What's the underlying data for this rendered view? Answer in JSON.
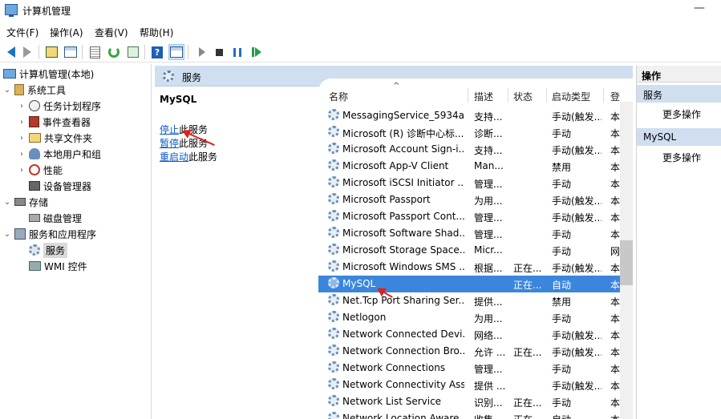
{
  "window": {
    "title": "计算机管理",
    "minimize_glyph": "—"
  },
  "menu": [
    "文件(F)",
    "操作(A)",
    "查看(V)",
    "帮助(H)"
  ],
  "tree": [
    {
      "label": "计算机管理(本地)",
      "icon": "computer-icon",
      "chev": ""
    },
    {
      "label": "系统工具",
      "icon": "tools-icon",
      "chev": "⌄"
    },
    {
      "label": "任务计划程序",
      "icon": "clock-icon",
      "chev": "›"
    },
    {
      "label": "事件查看器",
      "icon": "event-viewer-icon",
      "chev": "›"
    },
    {
      "label": "共享文件夹",
      "icon": "shared-folder-icon",
      "chev": "›"
    },
    {
      "label": "本地用户和组",
      "icon": "users-icon",
      "chev": "›"
    },
    {
      "label": "性能",
      "icon": "performance-icon",
      "chev": "›"
    },
    {
      "label": "设备管理器",
      "icon": "device-manager-icon",
      "chev": ""
    },
    {
      "label": "存储",
      "icon": "storage-icon",
      "chev": "⌄"
    },
    {
      "label": "磁盘管理",
      "icon": "disk-icon",
      "chev": ""
    },
    {
      "label": "服务和应用程序",
      "icon": "services-apps-icon",
      "chev": "⌄"
    },
    {
      "label": "服务",
      "icon": "gear-icon",
      "chev": ""
    },
    {
      "label": "WMI 控件",
      "icon": "wmi-icon",
      "chev": ""
    }
  ],
  "header": {
    "label": "服务"
  },
  "detail": {
    "name": "MySQL",
    "stop_link": "停止",
    "stop_suffix": "此服务",
    "pause_link": "暂停",
    "pause_suffix": "此服务",
    "restart_link": "重启动",
    "restart_suffix": "此服务"
  },
  "columns": {
    "name": "名称",
    "desc": "描述",
    "status": "状态",
    "startup": "启动类型",
    "logon": "登"
  },
  "services": [
    {
      "name": "MessagingService_5934a",
      "desc": "支持...",
      "status": "",
      "startup": "手动(触发...",
      "logon": "本"
    },
    {
      "name": "Microsoft (R) 诊断中心标...",
      "desc": "诊断...",
      "status": "",
      "startup": "手动",
      "logon": "本"
    },
    {
      "name": "Microsoft Account Sign-i...",
      "desc": "支持...",
      "status": "",
      "startup": "手动(触发...",
      "logon": "本"
    },
    {
      "name": "Microsoft App-V Client",
      "desc": "Man...",
      "status": "",
      "startup": "禁用",
      "logon": "本"
    },
    {
      "name": "Microsoft iSCSI Initiator ...",
      "desc": "管理...",
      "status": "",
      "startup": "手动",
      "logon": "本"
    },
    {
      "name": "Microsoft Passport",
      "desc": "为用...",
      "status": "",
      "startup": "手动(触发...",
      "logon": "本"
    },
    {
      "name": "Microsoft Passport Cont...",
      "desc": "管理...",
      "status": "",
      "startup": "手动(触发...",
      "logon": "本"
    },
    {
      "name": "Microsoft Software Shad...",
      "desc": "管理...",
      "status": "",
      "startup": "手动",
      "logon": "本"
    },
    {
      "name": "Microsoft Storage Space...",
      "desc": "Micr...",
      "status": "",
      "startup": "手动",
      "logon": "网"
    },
    {
      "name": "Microsoft Windows SMS ...",
      "desc": "根据...",
      "status": "正在...",
      "startup": "手动(触发...",
      "logon": "本"
    },
    {
      "name": "MySQL",
      "desc": "",
      "status": "正在...",
      "startup": "自动",
      "logon": "本"
    },
    {
      "name": "Net.Tcp Port Sharing Ser...",
      "desc": "提供...",
      "status": "",
      "startup": "禁用",
      "logon": "本"
    },
    {
      "name": "Netlogon",
      "desc": "为用...",
      "status": "",
      "startup": "手动",
      "logon": "本"
    },
    {
      "name": "Network Connected Devi...",
      "desc": "网络...",
      "status": "",
      "startup": "手动(触发...",
      "logon": "本"
    },
    {
      "name": "Network Connection Bro...",
      "desc": "允许 ...",
      "status": "正在...",
      "startup": "手动(触发...",
      "logon": "本"
    },
    {
      "name": "Network Connections",
      "desc": "管理...",
      "status": "",
      "startup": "手动",
      "logon": "本"
    },
    {
      "name": "Network Connectivity Ass...",
      "desc": "提供 ...",
      "status": "",
      "startup": "手动(触发...",
      "logon": "本"
    },
    {
      "name": "Network List Service",
      "desc": "识别...",
      "status": "正在...",
      "startup": "手动",
      "logon": "本"
    },
    {
      "name": "Network Location Aware...",
      "desc": "收集...",
      "status": "正在...",
      "startup": "自动",
      "logon": "本"
    }
  ],
  "actions": {
    "header": "操作",
    "sections": [
      {
        "title": "服务",
        "more": "更多操作"
      },
      {
        "title": "MySQL",
        "more": "更多操作"
      }
    ]
  },
  "colors": {
    "selection": "#3b86dc",
    "header_band": "#cfdff0",
    "link": "#0b57c9",
    "annotation": "#e02020"
  }
}
